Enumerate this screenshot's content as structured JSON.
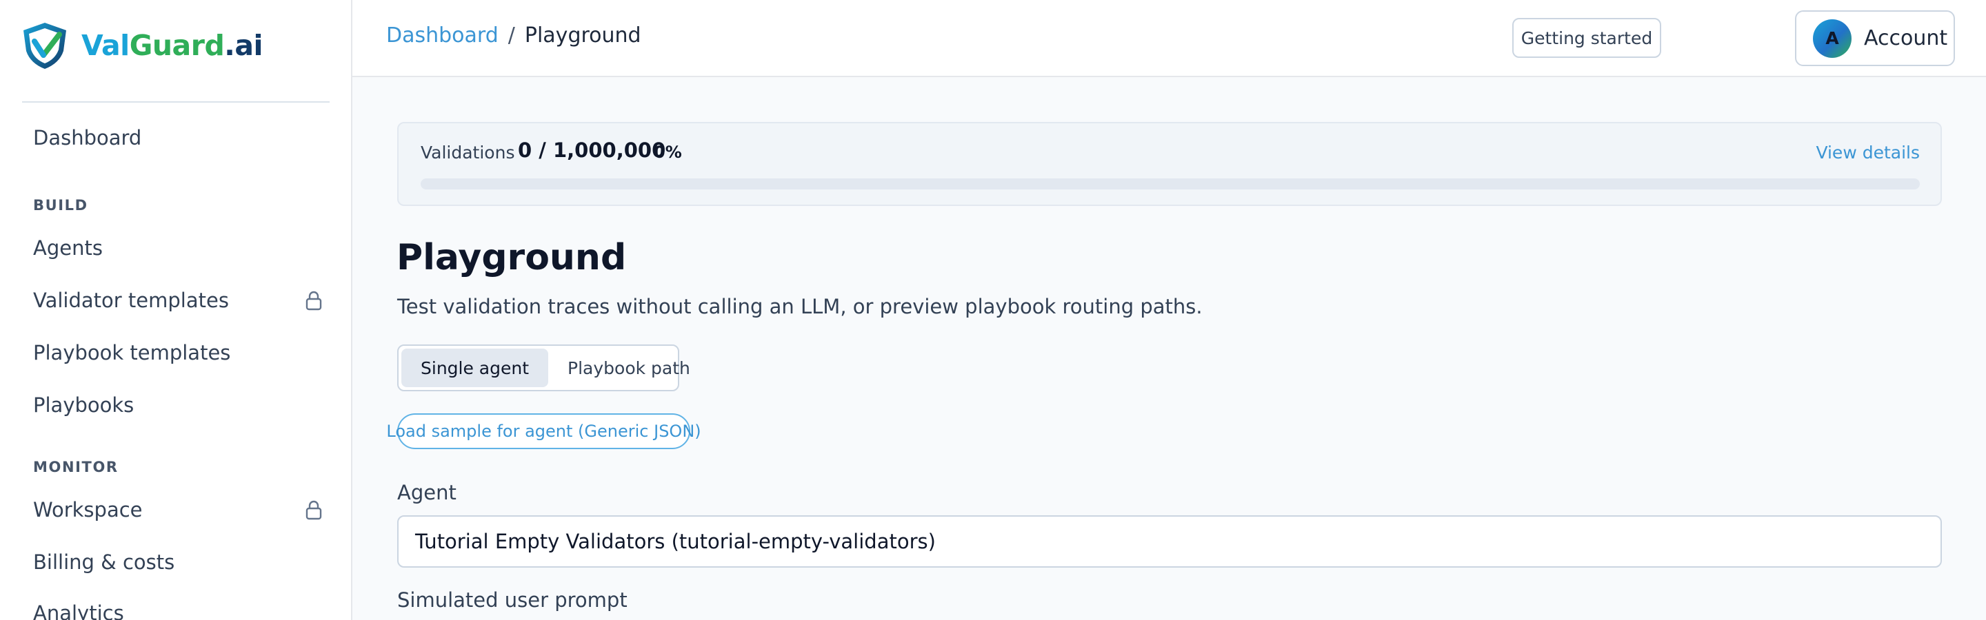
{
  "brand": {
    "part1": "Val",
    "part2": "Guard",
    "part3": ".ai"
  },
  "sidebar": {
    "dashboard": "Dashboard",
    "build_heading": "BUILD",
    "build_items": [
      {
        "label": "Agents",
        "locked": false
      },
      {
        "label": "Validator templates",
        "locked": true
      },
      {
        "label": "Playbook templates",
        "locked": false
      },
      {
        "label": "Playbooks",
        "locked": false
      }
    ],
    "monitor_heading": "MONITOR",
    "monitor_items": [
      {
        "label": "Workspace",
        "locked": true
      },
      {
        "label": "Billing & costs",
        "locked": false
      },
      {
        "label": "Analytics",
        "locked": false
      }
    ]
  },
  "header": {
    "breadcrumb_root": "Dashboard",
    "breadcrumb_sep": "/",
    "breadcrumb_current": "Playground",
    "getting_started": "Getting started",
    "account_initial": "A",
    "account_label": "Account"
  },
  "usage": {
    "label": "Validations",
    "count": "0 / 1,000,000",
    "percent": "0%",
    "progress_fraction": 0,
    "view_details": "View details"
  },
  "page": {
    "title": "Playground",
    "subtitle": "Test validation traces without calling an LLM, or preview playbook routing paths."
  },
  "mode_tabs": {
    "single": "Single agent",
    "playbook": "Playbook path",
    "active": "single"
  },
  "sample_button": "Load sample for agent (Generic JSON)",
  "agent": {
    "label": "Agent",
    "value": "Tutorial Empty Validators (tutorial-empty-validators)"
  },
  "prompt": {
    "label": "Simulated user prompt"
  },
  "colors": {
    "accent": "#3b95d4",
    "brand_blue": "#1aa3d8",
    "brand_green": "#2fae58",
    "brand_navy": "#123a67"
  }
}
